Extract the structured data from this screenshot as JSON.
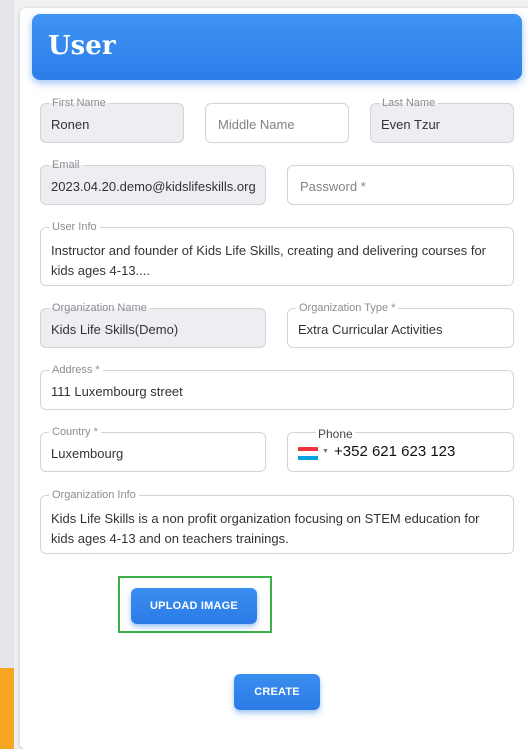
{
  "page": {
    "title": "User"
  },
  "form": {
    "first_name": {
      "label": "First Name",
      "value": "Ronen"
    },
    "middle_name": {
      "placeholder": "Middle Name"
    },
    "last_name": {
      "label": "Last Name",
      "value": "Even Tzur"
    },
    "email": {
      "label": "Email",
      "value": "2023.04.20.demo@kidslifeskills.org"
    },
    "password": {
      "placeholder": "Password *"
    },
    "user_info": {
      "label": "User Info",
      "value": "Instructor and founder of Kids Life Skills, creating and delivering courses for kids ages 4-13...."
    },
    "organization_name": {
      "label": "Organization Name",
      "value": "Kids Life Skills(Demo)"
    },
    "organization_type": {
      "label": "Organization Type *",
      "value": "Extra Curricular Activities"
    },
    "address": {
      "label": "Address *",
      "value": "111 Luxembourg street"
    },
    "country": {
      "label": "Country *",
      "value": "Luxembourg"
    },
    "phone": {
      "label": "Phone",
      "value": "+352 621 623 123",
      "flag_icon": "luxembourg-flag-icon",
      "flag_colors": [
        "#ef3340",
        "#ffffff",
        "#00a3e0"
      ]
    },
    "organization_info": {
      "label": "Organization Info",
      "value": "Kids Life Skills is a non profit organization focusing on STEM education for kids ages 4-13 and on teachers trainings."
    }
  },
  "buttons": {
    "upload_image": "UPLOAD IMAGE",
    "create": "CREATE"
  },
  "colors": {
    "accent": "#2b7de9",
    "highlight": "#3eb049",
    "side_accent": "#f6a623"
  }
}
